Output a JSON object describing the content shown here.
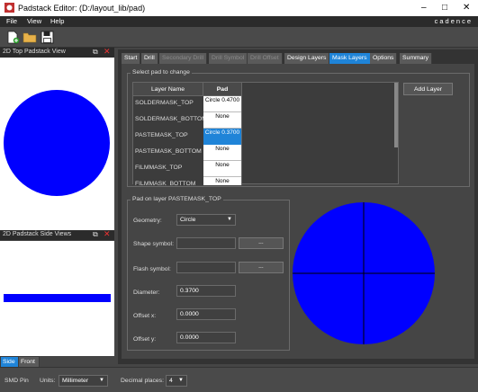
{
  "window": {
    "title": "Padstack Editor:  (D:/layout_lib/pad)",
    "brand": "cadence"
  },
  "menu": [
    "File",
    "View",
    "Help"
  ],
  "panels": {
    "top_view": "2D Top Padstack View",
    "side_view": "2D Padstack Side Views"
  },
  "side_tabs": [
    "Side",
    "Front"
  ],
  "tabs": [
    {
      "label": "Start",
      "state": "normal"
    },
    {
      "label": "Drill",
      "state": "normal"
    },
    {
      "label": "Secondary Drill",
      "state": "disabled"
    },
    {
      "label": "Drill Symbol",
      "state": "disabled"
    },
    {
      "label": "Drill Offset",
      "state": "disabled"
    },
    {
      "label": "Design Layers",
      "state": "normal"
    },
    {
      "label": "Mask Layers",
      "state": "active"
    },
    {
      "label": "Options",
      "state": "normal"
    },
    {
      "label": "Summary",
      "state": "normal"
    }
  ],
  "select_pad": {
    "title": "Select pad to change",
    "col_layer": "Layer Name",
    "col_pad": "Pad",
    "add_layer": "Add Layer",
    "rows": [
      {
        "layer": "SOLDERMASK_TOP",
        "pad": "Circle 0.4700"
      },
      {
        "layer": "SOLDERMASK_BOTTOM",
        "pad": "None"
      },
      {
        "layer": "PASTEMASK_TOP",
        "pad": "Circle 0.3700"
      },
      {
        "layer": "PASTEMASK_BOTTOM",
        "pad": "None"
      },
      {
        "layer": "FILMMASK_TOP",
        "pad": "None"
      },
      {
        "layer": "FILMMASK_BOTTOM",
        "pad": "None"
      }
    ]
  },
  "pad_on_layer": {
    "title": "Pad on layer PASTEMASK_TOP",
    "geometry_label": "Geometry:",
    "geometry_value": "Circle",
    "shape_label": "Shape symbol:",
    "shape_value": "",
    "shape_btn": "...",
    "flash_label": "Flash symbol:",
    "flash_value": "",
    "flash_btn": "...",
    "diameter_label": "Diameter:",
    "diameter_value": "0.3700",
    "offx_label": "Offset x:",
    "offx_value": "0.0000",
    "offy_label": "Offset y:",
    "offy_value": "0.0000"
  },
  "status": {
    "type": "SMD Pin",
    "units_label": "Units:",
    "units_value": "Millimeter",
    "decimals_label": "Decimal places:",
    "decimals_value": "4"
  },
  "colors": {
    "pad": "#0000ff",
    "accent": "#1f84d8"
  }
}
